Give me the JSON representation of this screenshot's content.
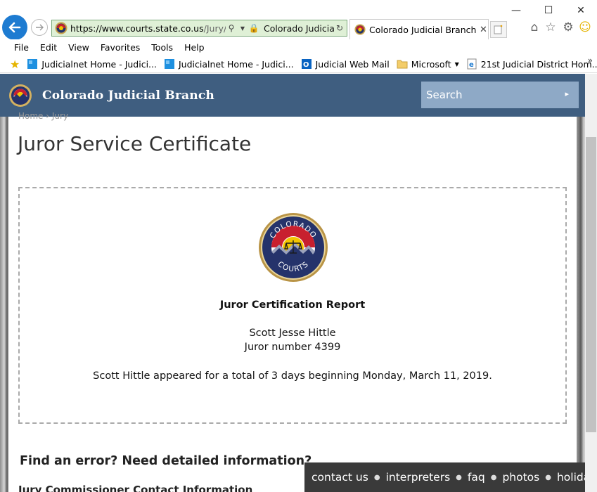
{
  "browser": {
    "url_domain": "https://www.courts.state.co.us",
    "url_rest": "/Jury/certif",
    "site_label": "Colorado Judicia...",
    "tab_title": "Colorado Judicial Branch - J...",
    "menu": [
      "File",
      "Edit",
      "View",
      "Favorites",
      "Tools",
      "Help"
    ],
    "favorites": [
      {
        "label": "Judicialnet Home - Judici...",
        "icon": "windows-tile-icon"
      },
      {
        "label": "Judicialnet Home - Judici...",
        "icon": "windows-tile-icon"
      },
      {
        "label": "Judicial Web Mail",
        "icon": "outlook-icon"
      },
      {
        "label": "Microsoft",
        "icon": "folder-icon"
      },
      {
        "label": "21st Judicial District Hom...",
        "icon": "ie-page-icon"
      }
    ],
    "accent_color": "#1d7bd1",
    "address_bg": "#dff0d6"
  },
  "site": {
    "title": "Colorado Judicial Branch",
    "search_placeholder": "Search",
    "breadcrumb": "Home  ›  Jury",
    "header_color": "#3f5e80"
  },
  "page": {
    "title": "Juror Service Certificate",
    "seal": {
      "top_text": "COLORADO",
      "bottom_text": "COURTS"
    },
    "cert_heading": "Juror Certification Report",
    "juror_name": "Scott Jesse Hittle",
    "juror_number": "Juror number 4399",
    "service_text": "Scott Hittle appeared for a total of 3 days beginning Monday, March 11, 2019.",
    "find_error": "Find an error? Need detailed information?",
    "contact_heading": "Jury Commissioner Contact Information"
  },
  "footer_links": [
    "contact us",
    "interpreters",
    "faq",
    "photos",
    "holidays"
  ]
}
